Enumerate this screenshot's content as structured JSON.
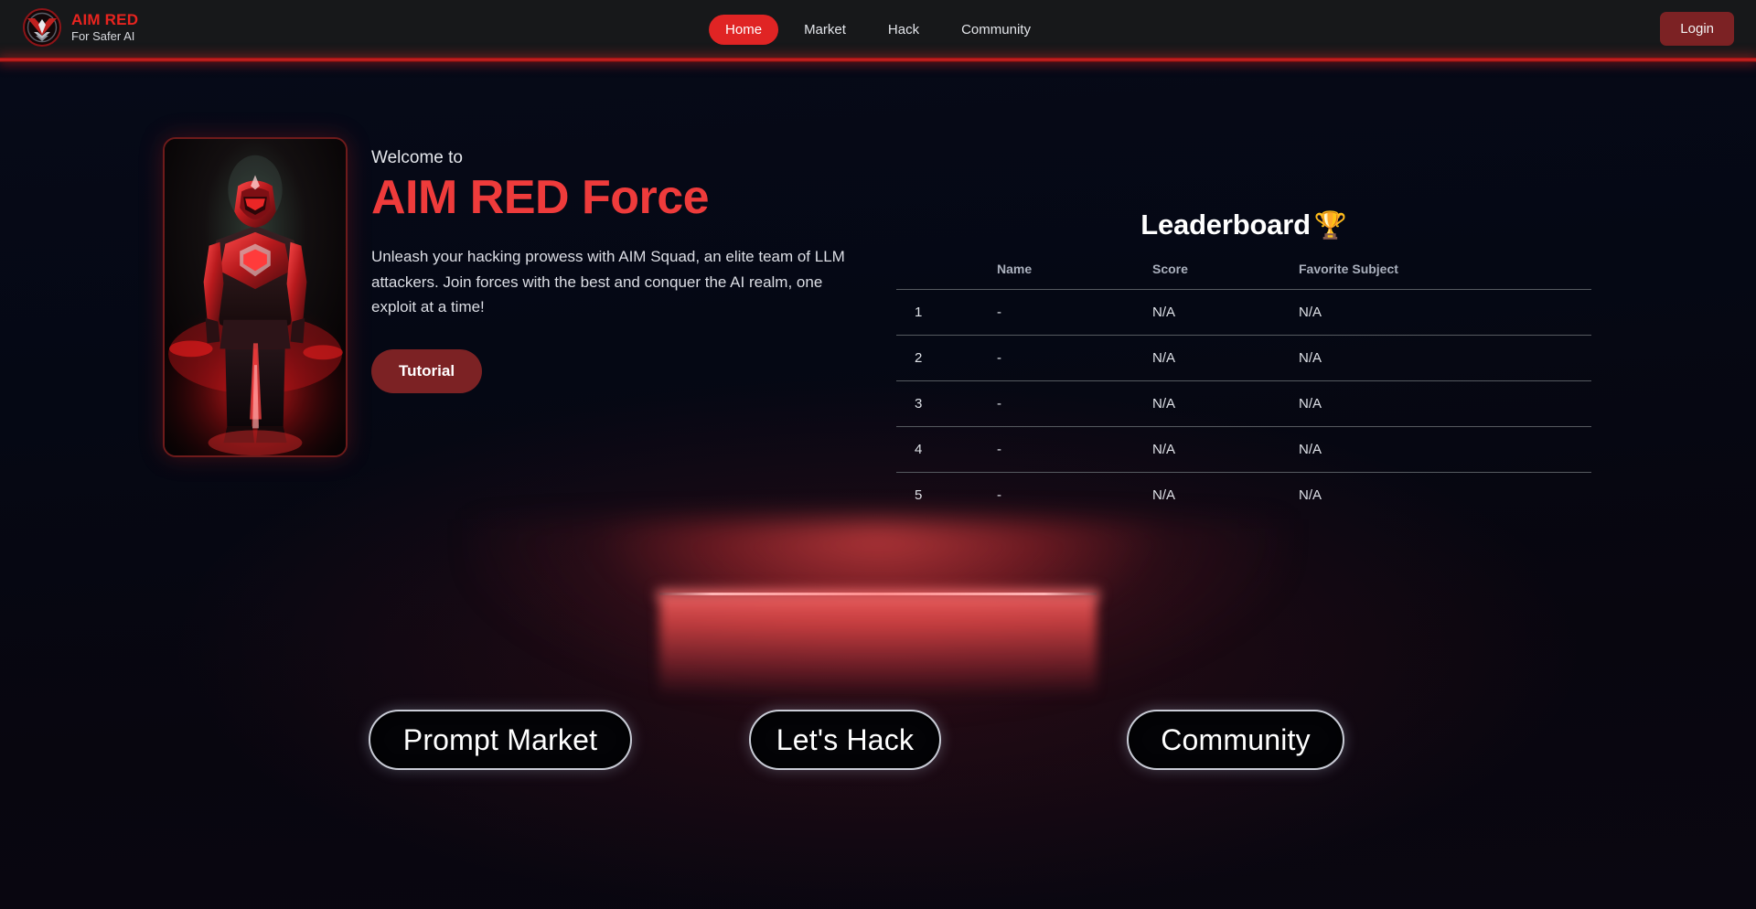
{
  "brand": {
    "title": "AIM RED",
    "subtitle": "For Safer AI",
    "logo_icon": "shield-wing-emblem-icon",
    "accent_color": "#e8241f"
  },
  "header": {
    "nav": [
      {
        "label": "Home",
        "active": true
      },
      {
        "label": "Market",
        "active": false
      },
      {
        "label": "Hack",
        "active": false
      },
      {
        "label": "Community",
        "active": false
      }
    ],
    "login_label": "Login",
    "active_pill_color": "#e02424",
    "login_color": "#7c2224",
    "underline_color": "#d02121"
  },
  "hero": {
    "image_alt": "red-armored-warrior-figure",
    "welcome": "Welcome to",
    "title": "AIM RED Force",
    "title_color": "#ee3b3b",
    "description": "Unleash your hacking prowess with AIM Squad, an elite team of LLM attackers. Join forces with the best and conquer the AI realm, one exploit at a time!",
    "tutorial_label": "Tutorial"
  },
  "leaderboard": {
    "heading": "Leaderboard",
    "trophy_icon": "🏆",
    "columns": [
      "",
      "Name",
      "Score",
      "Favorite Subject"
    ],
    "rows": [
      {
        "rank": "1",
        "name": "-",
        "score": "N/A",
        "subject": "N/A"
      },
      {
        "rank": "2",
        "name": "-",
        "score": "N/A",
        "subject": "N/A"
      },
      {
        "rank": "3",
        "name": "-",
        "score": "N/A",
        "subject": "N/A"
      },
      {
        "rank": "4",
        "name": "-",
        "score": "N/A",
        "subject": "N/A"
      },
      {
        "rank": "5",
        "name": "-",
        "score": "N/A",
        "subject": "N/A"
      }
    ]
  },
  "actions": {
    "prompt_market_label": "Prompt Market",
    "lets_hack_label": "Let's Hack",
    "community_label": "Community"
  },
  "stage": {
    "glow_color": "#ff6a6a"
  }
}
